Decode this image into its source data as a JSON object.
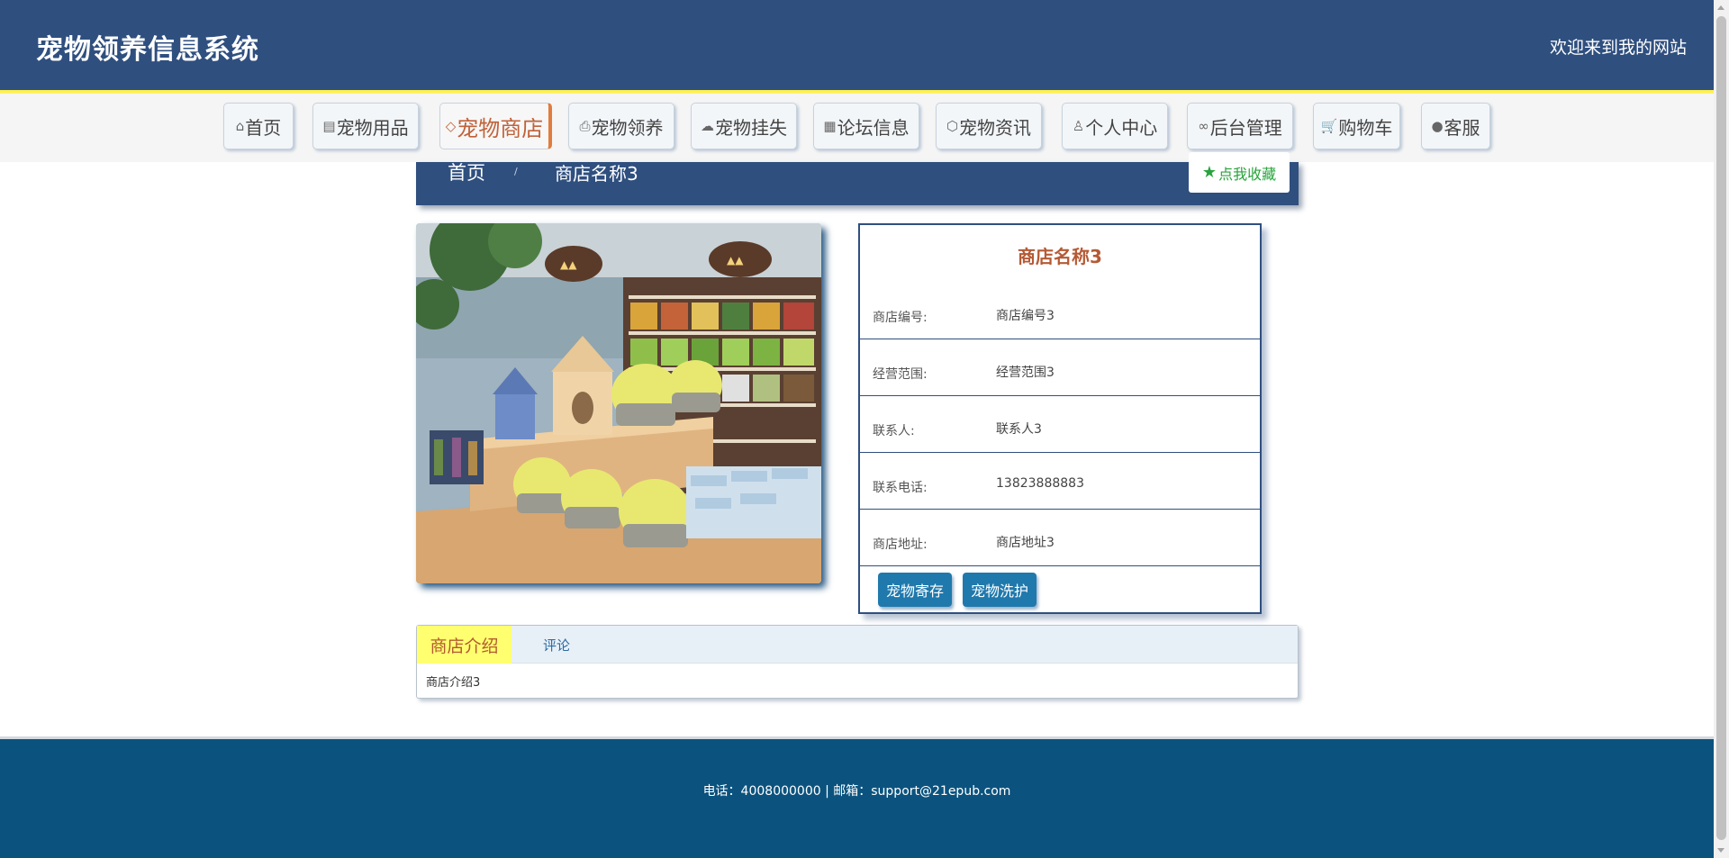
{
  "header": {
    "site_title": "宠物领养信息系统",
    "welcome": "欢迎来到我的网站"
  },
  "nav": {
    "items": [
      {
        "label": "首页",
        "icon": "home-icon",
        "glyph": "⌂"
      },
      {
        "label": "宠物用品",
        "icon": "newspaper-icon",
        "glyph": "▤"
      },
      {
        "label": "宠物商店",
        "icon": "tag-icon",
        "glyph": "◇"
      },
      {
        "label": "宠物领养",
        "icon": "printer-icon",
        "glyph": "⎙"
      },
      {
        "label": "宠物挂失",
        "icon": "cloud-icon",
        "glyph": "☁"
      },
      {
        "label": "论坛信息",
        "icon": "gift-icon",
        "glyph": "▦"
      },
      {
        "label": "宠物资讯",
        "icon": "cube-icon",
        "glyph": "⬡"
      },
      {
        "label": "个人中心",
        "icon": "user-icon",
        "glyph": "♙"
      },
      {
        "label": "后台管理",
        "icon": "link-icon",
        "glyph": "∞"
      },
      {
        "label": "购物车",
        "icon": "cart-icon",
        "glyph": "🛒"
      },
      {
        "label": "客服",
        "icon": "chat-icon",
        "glyph": "●"
      }
    ],
    "active_index": 2
  },
  "breadcrumb": {
    "home": "首页",
    "separator": "/",
    "current": "商店名称3"
  },
  "favorite": {
    "label": "点我收藏",
    "icon": "star-icon"
  },
  "shop": {
    "name": "商店名称3",
    "fields": [
      {
        "label": "商店编号:",
        "value": "商店编号3"
      },
      {
        "label": "经营范围:",
        "value": "经营范围3"
      },
      {
        "label": "联系人:",
        "value": "联系人3"
      },
      {
        "label": "联系电话:",
        "value": "13823888883"
      },
      {
        "label": "商店地址:",
        "value": "商店地址3"
      }
    ],
    "actions": [
      "宠物寄存",
      "宠物洗护"
    ]
  },
  "tabs": {
    "active": "商店介绍",
    "other": "评论",
    "content": "商店介绍3"
  },
  "footer": {
    "text": "电话：4008000000 | 邮箱：support@21epub.com"
  },
  "colors": {
    "header_bg": "#2f4f7f",
    "accent_orange": "#c0623a",
    "button_blue": "#1f79ad",
    "footer_bg": "#0b537e",
    "tab_active_bg": "#ffff70",
    "favorite_green": "#27a33b"
  }
}
